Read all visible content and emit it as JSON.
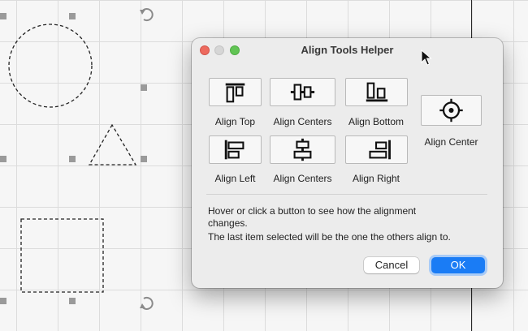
{
  "canvas": {
    "shapes": [
      "circle",
      "triangle",
      "square"
    ],
    "handle_icon": "selection-handle-icon",
    "rotate_icon": "rotate-icon"
  },
  "dialog": {
    "title": "Align Tools Helper",
    "buttons": {
      "align_top": {
        "label": "Align Top",
        "icon": "align-top-icon"
      },
      "align_centers_vertical": {
        "label": "Align Centers",
        "icon": "align-centers-vertical-icon"
      },
      "align_bottom": {
        "label": "Align Bottom",
        "icon": "align-bottom-icon"
      },
      "align_center": {
        "label": "Align Center",
        "icon": "crosshair-icon"
      },
      "align_left": {
        "label": "Align Left",
        "icon": "align-left-icon"
      },
      "align_centers_horizontal": {
        "label": "Align Centers",
        "icon": "align-centers-horizontal-icon"
      },
      "align_right": {
        "label": "Align Right",
        "icon": "align-right-icon"
      }
    },
    "help": {
      "line1": "Hover or click a button to see how the alignment",
      "line2": "changes.",
      "line3": "The last item selected will be the one the others align to."
    },
    "cancel_label": "Cancel",
    "ok_label": "OK"
  },
  "colors": {
    "ok_blue": "#1a7cf5",
    "close_red": "#ed6a5e",
    "zoom_green": "#61c454"
  }
}
